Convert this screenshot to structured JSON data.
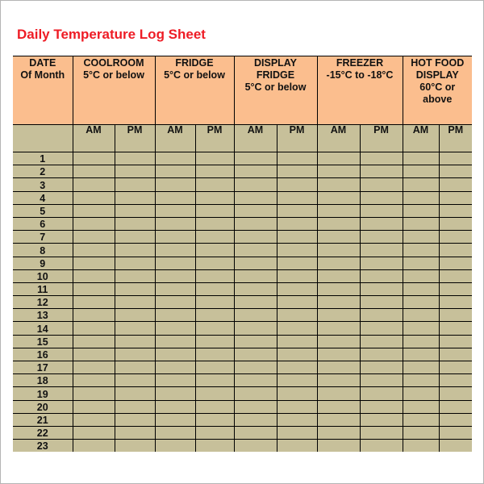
{
  "title": "Daily Temperature Log Sheet",
  "colors": {
    "title": "#ee1c25",
    "header_bg": "#fbbe8e",
    "body_bg": "#c7c09a",
    "grid": "#000000"
  },
  "table": {
    "date_header": [
      "DATE",
      "Of Month"
    ],
    "groups": [
      {
        "name": "COOLROOM",
        "lines": [
          "COOLROOM",
          "5°C or below"
        ]
      },
      {
        "name": "FRIDGE",
        "lines": [
          "FRIDGE",
          "5°C or below"
        ]
      },
      {
        "name": "DISPLAY FRIDGE",
        "lines": [
          "DISPLAY",
          "FRIDGE",
          "5°C or below"
        ]
      },
      {
        "name": "FREEZER",
        "lines": [
          "FREEZER",
          "-15°C to -18°C"
        ]
      },
      {
        "name": "HOT FOOD DISPLAY",
        "lines": [
          "HOT FOOD",
          "DISPLAY",
          "60°C or",
          "above"
        ]
      }
    ],
    "sub_labels": [
      "AM",
      "PM"
    ],
    "days": [
      "1",
      "2",
      "3",
      "4",
      "5",
      "6",
      "7",
      "8",
      "9",
      "10",
      "11",
      "12",
      "13",
      "14",
      "15",
      "16",
      "17",
      "18",
      "19",
      "20",
      "21",
      "22",
      "23"
    ]
  }
}
